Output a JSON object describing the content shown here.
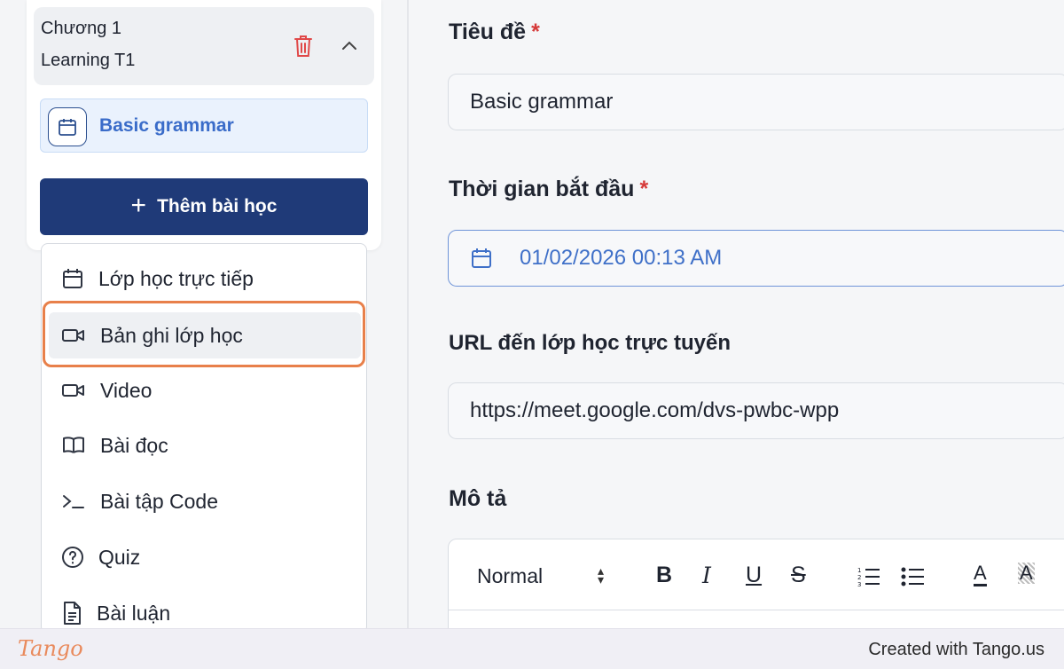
{
  "chapter": {
    "title_line1": "Chương 1",
    "title_line2": "Learning T1"
  },
  "lesson": {
    "label": "Basic grammar"
  },
  "add_lesson_button": "Thêm bài học",
  "lesson_type_menu": {
    "items": [
      {
        "label": "Lớp học trực tiếp",
        "icon": "calendar-icon"
      },
      {
        "label": "Bản ghi lớp học",
        "icon": "video-camera-icon",
        "highlighted": true
      },
      {
        "label": "Video",
        "icon": "video-camera-icon"
      },
      {
        "label": "Bài đọc",
        "icon": "open-book-icon"
      },
      {
        "label": "Bài tập Code",
        "icon": "terminal-icon"
      },
      {
        "label": "Quiz",
        "icon": "question-circle-icon"
      },
      {
        "label": "Bài luận",
        "icon": "document-icon"
      }
    ]
  },
  "form": {
    "title_label": "Tiêu đề",
    "title_value": "Basic grammar",
    "start_time_label": "Thời gian bắt đầu",
    "start_time_value": "01/02/2026 00:13 AM",
    "url_label": "URL đến lớp học trực tuyến",
    "url_value": "https://meet.google.com/dvs-pwbc-wpp",
    "description_label": "Mô tả",
    "required_mark": "*"
  },
  "editor_toolbar": {
    "style_select": "Normal",
    "bold": "B",
    "italic": "I",
    "underline": "U",
    "strike": "S",
    "text_color": "A"
  },
  "footer": {
    "logo": "Tango",
    "created_with": "Created with Tango.us"
  },
  "colors": {
    "primary_button": "#1f3a78",
    "highlight_ring": "#e8804a",
    "required": "#d63a3a",
    "link_blue": "#3a6cc9"
  }
}
